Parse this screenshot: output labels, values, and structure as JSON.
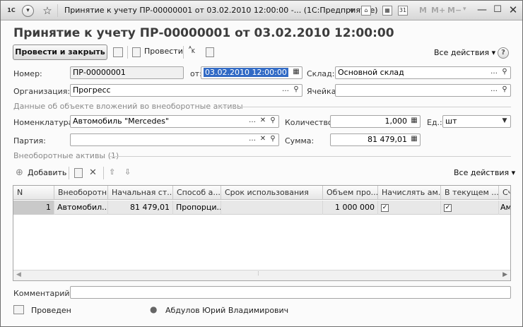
{
  "window": {
    "title": "Принятие к учету ПР-00000001 от 03.02.2010 12:00:00 -... (1С:Предприятие)",
    "app_icon": "1С",
    "m_buttons": [
      "M",
      "M+",
      "M−"
    ]
  },
  "heading": "Принятие к учету ПР-00000001 от 03.02.2010 12:00:00",
  "toolbar": {
    "post_close": "Провести и закрыть",
    "post": "Провести",
    "all_actions": "Все действия ▾"
  },
  "form": {
    "number_label": "Номер:",
    "number_value": "ПР-00000001",
    "date_label": "от:",
    "date_value": "03.02.2010 12:00:00",
    "warehouse_label": "Склад:",
    "warehouse_value": "Основной склад",
    "org_label": "Организация:",
    "org_value": "Прогресс",
    "cell_label": "Ячейка:",
    "cell_value": "",
    "group1_title": "Данные об объекте вложений во внеоборотные активы",
    "nomenclature_label": "Номенклатура:",
    "nomenclature_value": "Автомобиль \"Mercedes\"",
    "qty_label": "Количество:",
    "qty_value": "1,000",
    "unit_label": "Ед.:",
    "unit_value": "шт",
    "batch_label": "Партия:",
    "batch_value": "",
    "sum_label": "Сумма:",
    "sum_value": "81 479,01",
    "group2_title": "Внеоборотные активы (1)"
  },
  "table_toolbar": {
    "add": "Добавить",
    "all_actions": "Все действия ▾"
  },
  "table": {
    "headers": [
      "N",
      "Внеоборотн...",
      "Начальная ст...",
      "Способ а...",
      "Срок использования",
      "Объем про...",
      "Начислять ам...",
      "В текущем ...",
      "Сч"
    ],
    "rows": [
      {
        "n": "1",
        "asset": "Автомобил...",
        "start_cost": "81 479,01",
        "method": "Пропорци...",
        "term": "",
        "volume": "1 000 000",
        "charge": true,
        "current": true,
        "account": "Ам"
      }
    ]
  },
  "comment_label": "Комментарий:",
  "comment_value": "",
  "status": {
    "posted": "Проведен",
    "author": "Абдулов Юрий Владимирович"
  }
}
